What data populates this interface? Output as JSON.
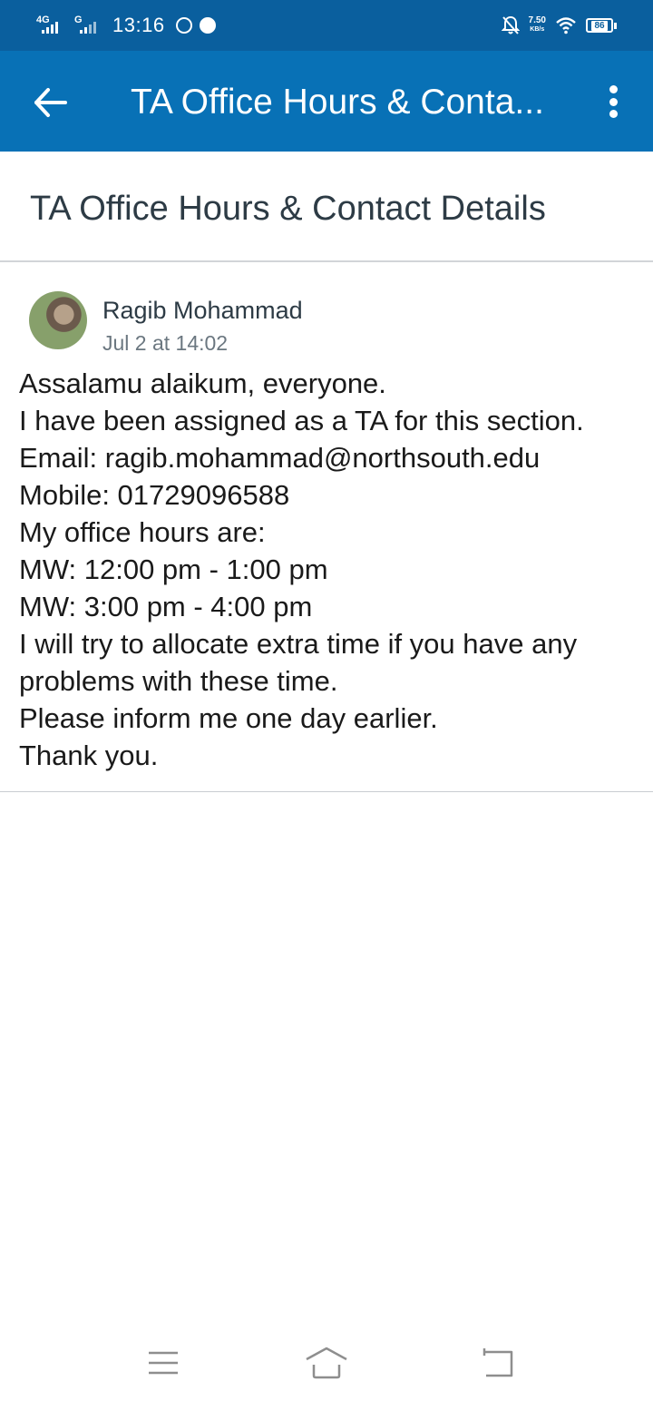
{
  "status_bar": {
    "network_1": "4G",
    "network_2": "G",
    "time": "13:16",
    "speed_value": "7.50",
    "speed_unit": "KB/s",
    "battery": "86"
  },
  "app_bar": {
    "title": "TA Office Hours & Conta..."
  },
  "page": {
    "title": "TA Office Hours & Contact Details"
  },
  "post": {
    "author": "Ragib Mohammad",
    "date": "Jul 2 at 14:02",
    "lines": [
      "Assalamu alaikum, everyone.",
      "I have been assigned as a TA for this section.",
      "Email: ragib.mohammad@northsouth.edu",
      "Mobile: 01729096588",
      "My office hours are:",
      "MW: 12:00 pm - 1:00 pm",
      "MW: 3:00 pm - 4:00 pm",
      "I will try to allocate extra time if you have any",
      "problems with these time.",
      "Please inform me one day earlier.",
      "Thank you."
    ]
  },
  "colors": {
    "status_bar": "#0a5f9e",
    "app_bar": "#0871b6",
    "title_text": "#2d3b45"
  },
  "icons": {
    "back": "arrow-left-icon",
    "more": "more-vertical-icon",
    "nav_menu": "menu-icon",
    "nav_home": "home-icon",
    "nav_back": "back-icon"
  }
}
